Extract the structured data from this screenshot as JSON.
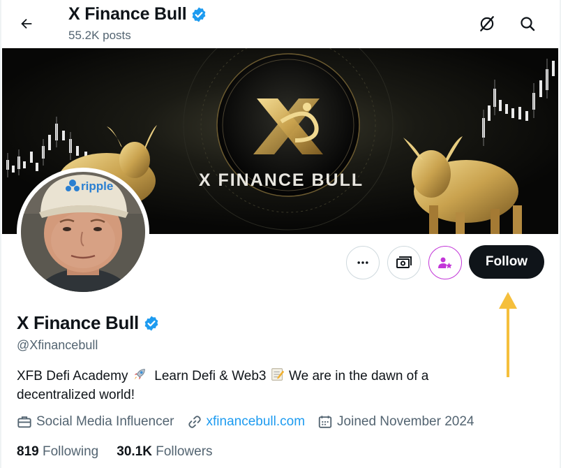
{
  "header": {
    "title": "X Finance Bull",
    "posts_count": "55.2K posts",
    "icons": [
      "back-arrow-icon",
      "verified-badge-icon",
      "grok-icon",
      "search-icon"
    ]
  },
  "banner": {
    "text": "X FINANCE BULL"
  },
  "actions": {
    "more_icon": "more-dots-icon",
    "subscribe_icon": "money-icon",
    "creator_icon": "person-star-icon",
    "follow_label": "Follow"
  },
  "profile": {
    "name": "X Finance Bull",
    "handle": "@Xfinancebull",
    "bio_line1_a": "XFB Defi Academy",
    "bio_line1_b": "Learn Defi & Web3",
    "bio_line1_c": "We are in the dawn of a",
    "bio_line2": "decentralized world!",
    "category": "Social Media Influencer",
    "website": "xfinancebull.com",
    "joined": "Joined November 2024",
    "following_count": "819",
    "following_label": "Following",
    "followers_count": "30.1K",
    "followers_label": "Followers",
    "cap_text": "ripple"
  },
  "colors": {
    "accent": "#1d9bf0",
    "text": "#0f1419",
    "muted": "#536471",
    "creator": "#c236d8",
    "arrow": "#f5bf3c",
    "gold": "#d6b25e"
  }
}
